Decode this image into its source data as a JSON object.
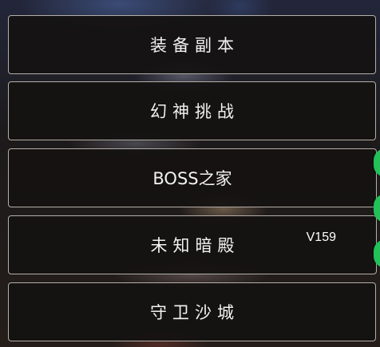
{
  "menu": {
    "items": [
      {
        "label": "装备副本"
      },
      {
        "label": "幻神挑战"
      },
      {
        "label": "BOSS之家"
      },
      {
        "label": "未知暗殿",
        "badge": "V159"
      },
      {
        "label": "守卫沙城"
      }
    ]
  },
  "colors": {
    "button_bg": "#141211",
    "button_border": "#b4afa8",
    "text": "#f2f2f2",
    "side_bubble": "#22c15a"
  }
}
